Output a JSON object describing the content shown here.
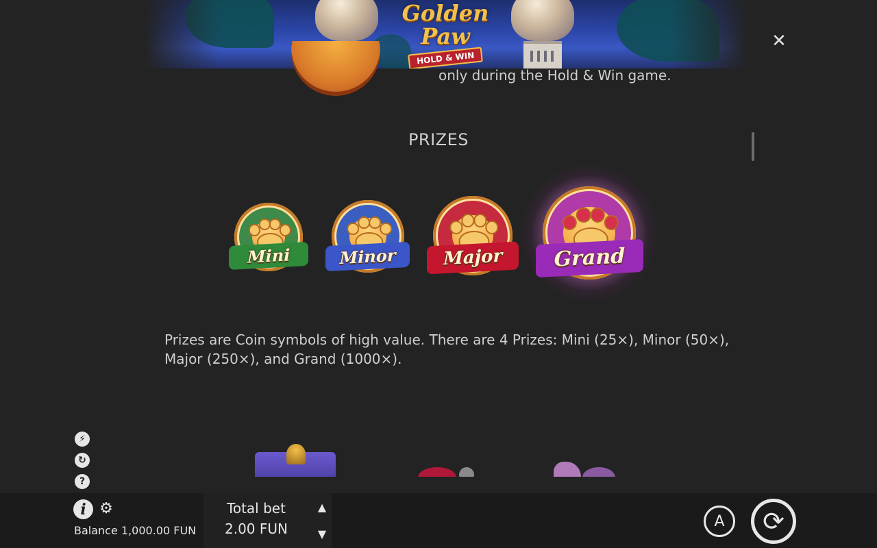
{
  "banner": {
    "logo_title": "Golden Paw",
    "logo_subtitle": "HOLD & WIN"
  },
  "close_icon": "close-icon",
  "content": {
    "partial_text": "only during the Hold & Win game.",
    "section_title": "PRIZES",
    "coins": [
      {
        "label": "Mini",
        "color": "#2f8a3a"
      },
      {
        "label": "Minor",
        "color": "#3a56c8"
      },
      {
        "label": "Major",
        "color": "#c4162e"
      },
      {
        "label": "Grand",
        "color": "#9a2ab8"
      }
    ],
    "description": "Prizes are Coin symbols of high value. There are 4 Prizes: Mini (25×), Minor (50×), Major (250×), and Grand (1000×)."
  },
  "side_icons": [
    "turbo-icon",
    "autoplay-speed-icon",
    "help-icon"
  ],
  "bottom_bar": {
    "balance": "Balance 1,000.00 FUN",
    "total_bet_label": "Total bet",
    "total_bet_value": "2.00 FUN",
    "auto_label": "A"
  }
}
